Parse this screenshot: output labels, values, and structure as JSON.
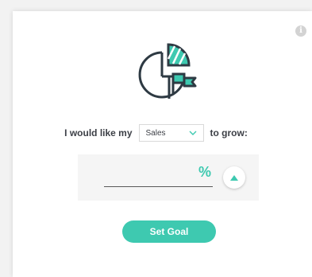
{
  "colors": {
    "accent": "#3ec9b0",
    "text": "#3d4047",
    "panel": "#f5f5f5"
  },
  "icons": {
    "info": "info-icon",
    "illustration": "pie-chart-with-flag-icon",
    "dropdown": "chevron-down-icon",
    "direction": "triangle-up-icon"
  },
  "info_label": "i",
  "sentence": {
    "prefix": "I would like my",
    "metric": "Sales",
    "suffix": "to grow:"
  },
  "goal": {
    "value": "",
    "unit": "%"
  },
  "submit_label": "Set Goal"
}
